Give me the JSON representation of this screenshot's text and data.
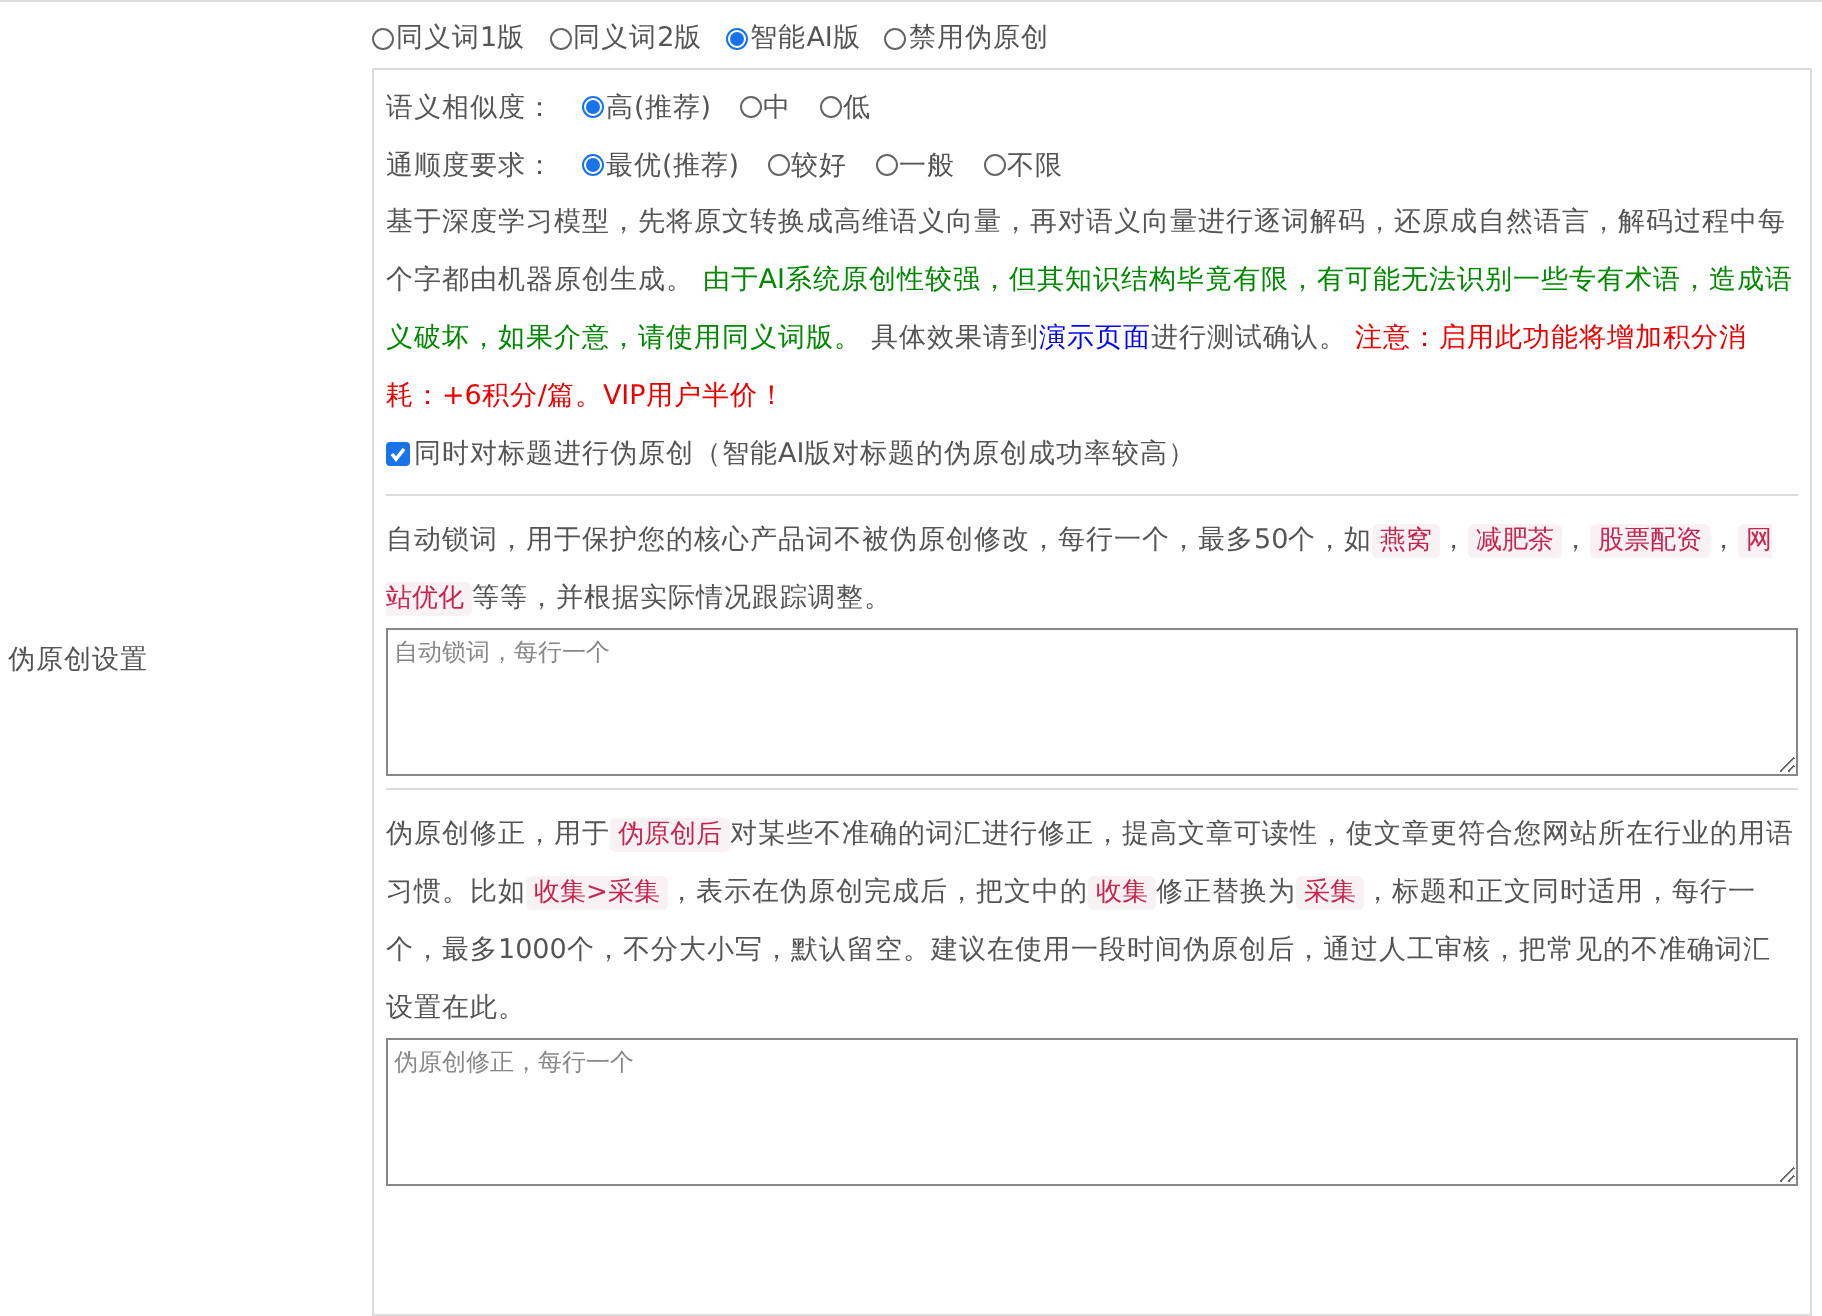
{
  "side_label": "伪原创设置",
  "modes": [
    {
      "label": "同义词1版",
      "selected": false
    },
    {
      "label": "同义词2版",
      "selected": false
    },
    {
      "label": "智能AI版",
      "selected": true
    },
    {
      "label": "禁用伪原创",
      "selected": false
    }
  ],
  "similarity": {
    "label": "语义相似度：",
    "options": [
      {
        "label": "高(推荐)",
        "selected": true
      },
      {
        "label": "中",
        "selected": false
      },
      {
        "label": "低",
        "selected": false
      }
    ]
  },
  "fluency": {
    "label": "通顺度要求：",
    "options": [
      {
        "label": "最优(推荐)",
        "selected": true
      },
      {
        "label": "较好",
        "selected": false
      },
      {
        "label": "一般",
        "selected": false
      },
      {
        "label": "不限",
        "selected": false
      }
    ]
  },
  "ai_description": [
    {
      "kind": "text",
      "text": "基于深度学习模型，先将原文转换成高维语义向量，再对语义向量进行逐词解码，还原成自然语言，解码过程中每个字都由机器原创生成。 "
    },
    {
      "kind": "green",
      "text": "由于AI系统原创性较强，但其知识结构毕竟有限，有可能无法识别一些专有术语，造成语义破坏，如果介意，请使用同义词版。"
    },
    {
      "kind": "text",
      "text": " 具体效果请到"
    },
    {
      "kind": "link",
      "text": "演示页面"
    },
    {
      "kind": "text",
      "text": "进行测试确认。 "
    },
    {
      "kind": "red",
      "text": "注意：启用此功能将增加积分消耗：+6积分/篇。VIP用户半价！"
    }
  ],
  "title_checkbox": {
    "label": "同时对标题进行伪原创（智能AI版对标题的伪原创成功率较高）",
    "checked": true
  },
  "lock_words": {
    "description": [
      {
        "kind": "text",
        "text": "自动锁词，用于保护您的核心产品词不被伪原创修改，每行一个，最多50个，如"
      },
      {
        "kind": "code",
        "text": "燕窝"
      },
      {
        "kind": "text",
        "text": "，"
      },
      {
        "kind": "code",
        "text": "减肥茶"
      },
      {
        "kind": "text",
        "text": "，"
      },
      {
        "kind": "code",
        "text": "股票配资"
      },
      {
        "kind": "text",
        "text": "，"
      },
      {
        "kind": "code",
        "text": "网站优化"
      },
      {
        "kind": "text",
        "text": "等等，并根据实际情况跟踪调整。"
      }
    ],
    "placeholder": "自动锁词，每行一个"
  },
  "correction": {
    "description": [
      {
        "kind": "text",
        "text": "伪原创修正，用于"
      },
      {
        "kind": "code",
        "text": "伪原创后"
      },
      {
        "kind": "text",
        "text": "对某些不准确的词汇进行修正，提高文章可读性，使文章更符合您网站所在行业的用语习惯。比如"
      },
      {
        "kind": "code",
        "text": "收集>采集"
      },
      {
        "kind": "text",
        "text": "，表示在伪原创完成后，把文中的"
      },
      {
        "kind": "code",
        "text": "收集"
      },
      {
        "kind": "text",
        "text": "修正替换为"
      },
      {
        "kind": "code",
        "text": "采集"
      },
      {
        "kind": "text",
        "text": "，标题和正文同时适用，每行一个，最多1000个，不分大小写，默认留空。建议在使用一段时间伪原创后，通过人工审核，把常见的不准确词汇设置在此。"
      }
    ],
    "placeholder": "伪原创修正，每行一个"
  }
}
